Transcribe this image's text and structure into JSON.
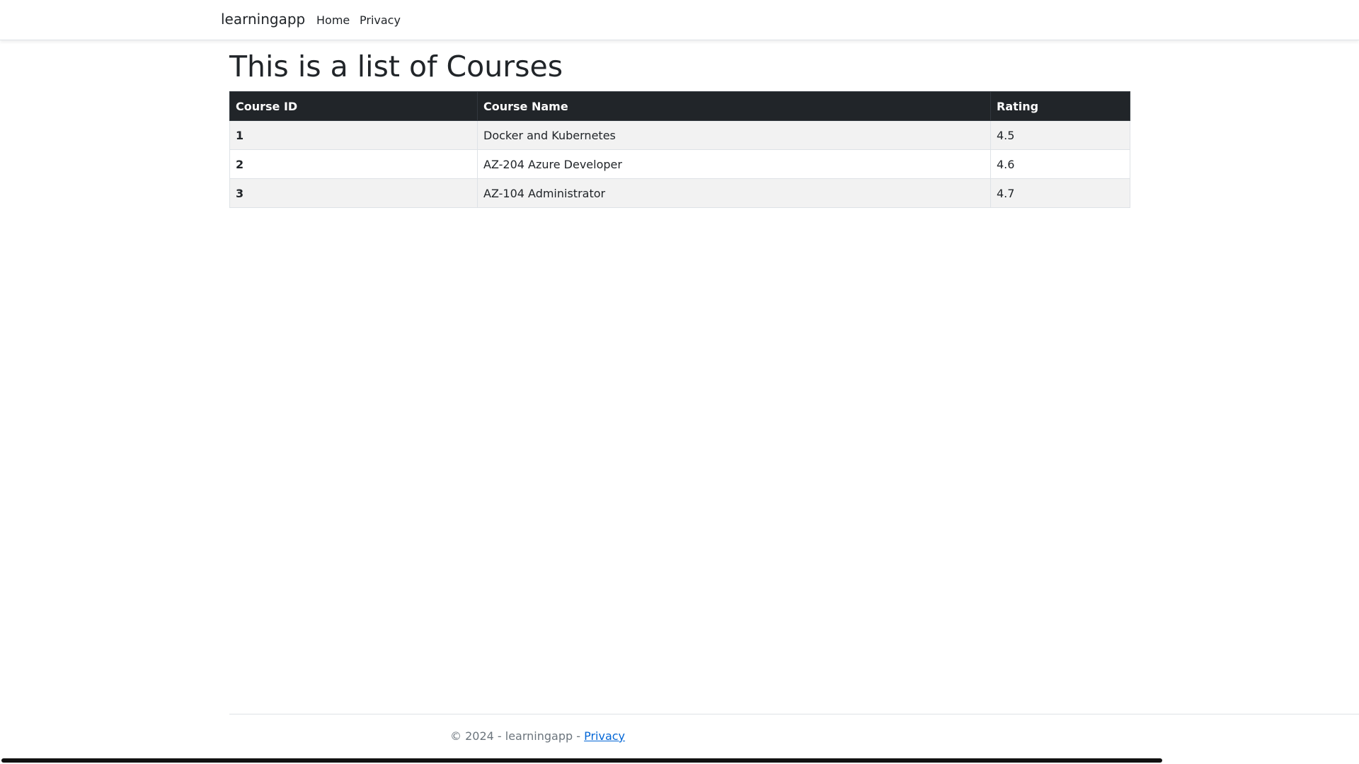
{
  "navbar": {
    "brand": "learningapp",
    "links": [
      {
        "label": "Home"
      },
      {
        "label": "Privacy"
      }
    ]
  },
  "main": {
    "title": "This is a list of Courses",
    "table": {
      "headers": [
        "Course ID",
        "Course Name",
        "Rating"
      ],
      "rows": [
        {
          "id": "1",
          "name": "Docker and Kubernetes",
          "rating": "4.5"
        },
        {
          "id": "2",
          "name": "AZ-204 Azure Developer",
          "rating": "4.6"
        },
        {
          "id": "3",
          "name": "AZ-104 Administrator",
          "rating": "4.7"
        }
      ]
    }
  },
  "footer": {
    "text": "© 2024 - learningapp - ",
    "link_label": "Privacy"
  },
  "colors": {
    "header_bg": "#212529",
    "link": "#0366d6",
    "stripe": "#f2f2f2"
  }
}
